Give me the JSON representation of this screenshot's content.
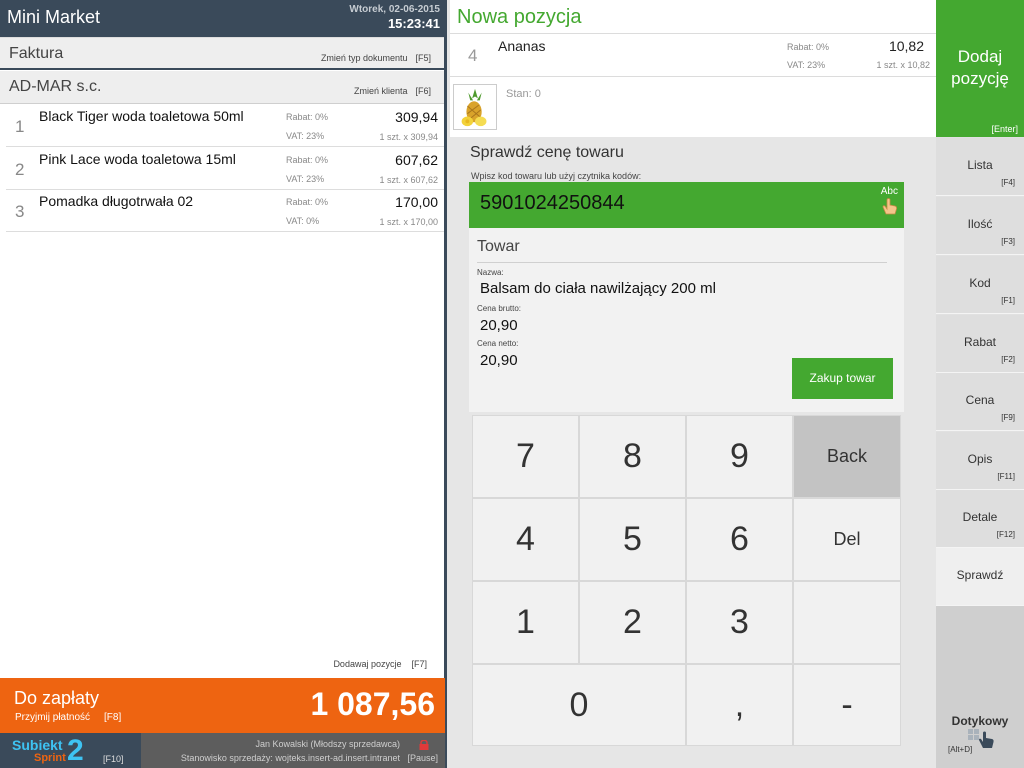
{
  "header": {
    "title": "Mini Market",
    "date": "Wtorek, 02-06-2015",
    "time": "15:23:41"
  },
  "document": {
    "type": "Faktura",
    "action": "Zmień typ dokumentu",
    "action_key": "[F5]"
  },
  "client": {
    "name": "AD-MAR s.c.",
    "action": "Zmień klienta",
    "action_key": "[F6]"
  },
  "items": [
    {
      "num": "1",
      "name": "Black Tiger woda toaletowa 50ml",
      "rabat": "Rabat:  0%",
      "vat": "VAT:  23%",
      "price": "309,94",
      "qty": "1 szt. x 309,94"
    },
    {
      "num": "2",
      "name": "Pink Lace woda toaletowa 15ml",
      "rabat": "Rabat:  0%",
      "vat": "VAT:  23%",
      "price": "607,62",
      "qty": "1 szt. x 607,62"
    },
    {
      "num": "3",
      "name": "Pomadka długotrwała 02",
      "rabat": "Rabat:  0%",
      "vat": "VAT:  0%",
      "price": "170,00",
      "qty": "1 szt. x 170,00"
    }
  ],
  "add_positions": {
    "label": "Dodawaj pozycje",
    "key": "[F7]"
  },
  "payment": {
    "title": "Do zapłaty",
    "sub": "Przyjmij płatność",
    "sub_key": "[F8]",
    "total": "1 087,56"
  },
  "footer": {
    "logo_subiekt": "Subiekt",
    "logo_sprint": "Sprint",
    "logo_2": "2",
    "logo_key": "[F10]",
    "user": "Jan Kowalski (Młodszy sprzedawca)",
    "station": "Stanowisko sprzedaży: wojteks.insert-ad.insert.intranet",
    "pause_key": "[Pause]"
  },
  "new_position": {
    "title": "Nowa pozycja",
    "num": "4",
    "name": "Ananas",
    "rabat": "Rabat:  0%",
    "vat": "VAT:  23%",
    "price": "10,82",
    "qty": "1 szt. x 10,82",
    "stock": "Stan: 0"
  },
  "check_price": {
    "title": "Sprawdź cenę towaru",
    "hint": "Wpisz kod towaru lub użyj czytnika kodów:",
    "code": "5901024250844",
    "abc": "Abc"
  },
  "product": {
    "heading": "Towar",
    "name_label": "Nazwa:",
    "name": "Balsam do ciała nawilżający 200 ml",
    "brutto_label": "Cena brutto:",
    "brutto": "20,90",
    "netto_label": "Cena netto:",
    "netto": "20,90",
    "buy_button": "Zakup towar"
  },
  "keypad": {
    "k7": "7",
    "k8": "8",
    "k9": "9",
    "back": "Back",
    "k4": "4",
    "k5": "5",
    "k6": "6",
    "del": "Del",
    "k1": "1",
    "k2": "2",
    "k3": "3",
    "k0": "0",
    "comma": ",",
    "minus": "-"
  },
  "right_menu": {
    "add": {
      "label": "Dodaj pozycję",
      "key": "[Enter]"
    },
    "buttons": [
      {
        "label": "Lista",
        "key": "[F4]"
      },
      {
        "label": "Ilość",
        "key": "[F3]"
      },
      {
        "label": "Kod",
        "key": "[F1]"
      },
      {
        "label": "Rabat",
        "key": "[F2]"
      },
      {
        "label": "Cena",
        "key": "[F9]"
      },
      {
        "label": "Opis",
        "key": "[F11]"
      },
      {
        "label": "Detale",
        "key": "[F12]"
      },
      {
        "label": "Sprawdź",
        "key": ""
      }
    ],
    "touch": {
      "label": "Dotykowy",
      "key": "[Alt+D]"
    }
  },
  "colors": {
    "green": "#44a830",
    "orange": "#ee6411",
    "header": "#3a4a5a"
  }
}
